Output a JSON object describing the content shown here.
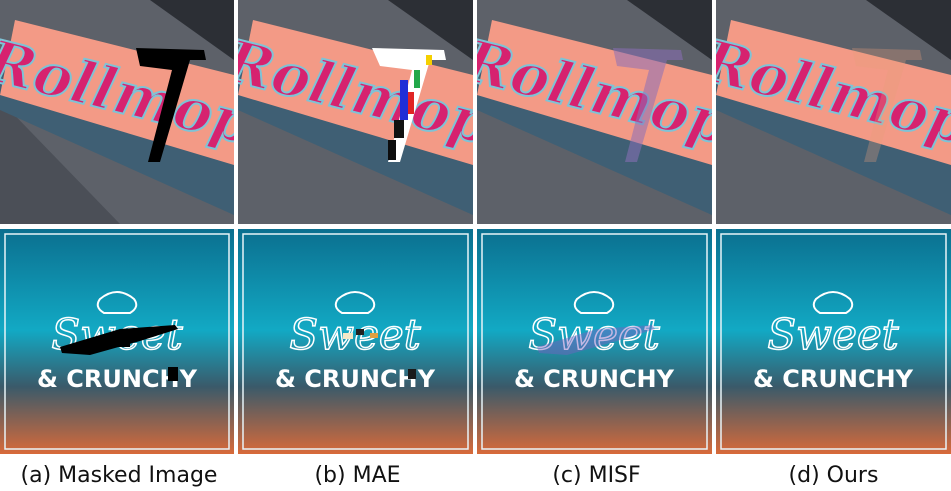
{
  "figure": {
    "columns": [
      {
        "id": "masked",
        "caption": "(a) Masked Image"
      },
      {
        "id": "mae",
        "caption": "(b) MAE"
      },
      {
        "id": "misf",
        "caption": "(c) MISF"
      },
      {
        "id": "ours",
        "caption": "(d) Ours"
      }
    ],
    "rows": [
      {
        "id": "rollmop",
        "sign_text": "Rollmop"
      },
      {
        "id": "sweet",
        "line1": "Sweet",
        "line2": "& CRUNCHY"
      }
    ],
    "colors": {
      "sign_face": "#f39a86",
      "sign_text": "#d6226f",
      "sign_text_outline": "#7ec3d6",
      "sign_base": "#3f5f74",
      "background_gray": "#5d6169",
      "poster_teal": "#0d90b0",
      "poster_orange": "#d86a3a",
      "mask_black": "#000000"
    }
  }
}
